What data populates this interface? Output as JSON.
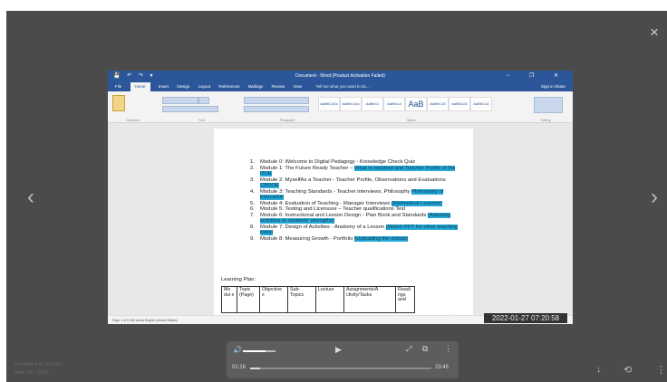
{
  "viewer": {
    "close_icon": "×",
    "prev_icon": "‹",
    "next_icon": "›",
    "timestamp": "2022-01-27 07:20:58",
    "file_name": "Unmodified file 01.mp4",
    "file_meta": "Video file · 23:45",
    "download_icon": "↓",
    "rotate_icon": "⟲",
    "more_icon": "⋮"
  },
  "player": {
    "current_time": "01:16",
    "total_time": "23:45",
    "progress": 0.053,
    "volume": 0.7,
    "volume_icon": "🔊",
    "play_icon": "▶",
    "fullscreen_icon": "⤢",
    "captions_icon": "⧉",
    "more_icon": "⋮"
  },
  "word": {
    "title": "Document - Word (Product Activation Failed)",
    "quick_access": "💾 ↶ ↷ ▾",
    "window_controls": "− ❐ ✕",
    "tabs": [
      "File",
      "Home",
      "Insert",
      "Design",
      "Layout",
      "References",
      "Mailings",
      "Review",
      "View"
    ],
    "active_tab": "Home",
    "tell_me": "Tell me what you want to do...",
    "share": "Sign in   Share",
    "styles": [
      "AaBbCcDc",
      "AaBbCcDc",
      "AaBbCc",
      "AaBbCcI",
      "AaB",
      "AaBbCcD",
      "AaBbCcD",
      "AaBbCcD"
    ],
    "ribbon_groups": [
      "Clipboard",
      "Font",
      "Paragraph",
      "Styles",
      "Editing"
    ],
    "status_left": "Page 1 of 5    545 words    English (United States)",
    "cursor_icon": "I"
  },
  "document": {
    "modules": [
      {
        "num": "1.",
        "text": "Module 0:  Welcome to Digital Pedagogy - Knowledge Check Quiz",
        "highlight": ""
      },
      {
        "num": "2.",
        "text": "Module 1:  The Future Ready Teacher – ",
        "highlight": "What is required and Teacher Profile of the DOE"
      },
      {
        "num": "3.",
        "text": "Module 2:  MyselfAs a Teacher - Teacher Profile, Observations and Evaluations ",
        "highlight": "CBDOE"
      },
      {
        "num": "4.",
        "text": "Module 3: Teaching Standards - Teacher interviews, Philosophy ",
        "highlight": "Philosophy of Education"
      },
      {
        "num": "5.",
        "text": "Module 4:  Evaluation of Teaching - Manager Interviews ",
        "highlight": "(Methodical Lessons)"
      },
      {
        "num": "6.",
        "text": "Module 5:  Testing and Licensure – Teacher qualifications Test",
        "highlight": ""
      },
      {
        "num": "7.",
        "text": "Module 6:  Instructional and Lesson Design - Plan Book and Standards ",
        "highlight": "(Adapting activities to students' strengths)"
      },
      {
        "num": "8.",
        "text": "Module 7:  Design of Activities - Anatomy of a Lesson ",
        "highlight": "(Watch PPT for other teaching tools)"
      },
      {
        "num": "9.",
        "text": "Module 8:  Measuring Growth - Portfolio ",
        "highlight": "(Uploading the videos)"
      }
    ],
    "learning_plan": "Learning Plan:",
    "table_headers": [
      "Mo dul e",
      "Topic (Page)",
      "Objective s",
      "Sub-Topics",
      "Lecture",
      "Assignments/A ctivity/Tasks",
      "Readi ngs and"
    ]
  }
}
